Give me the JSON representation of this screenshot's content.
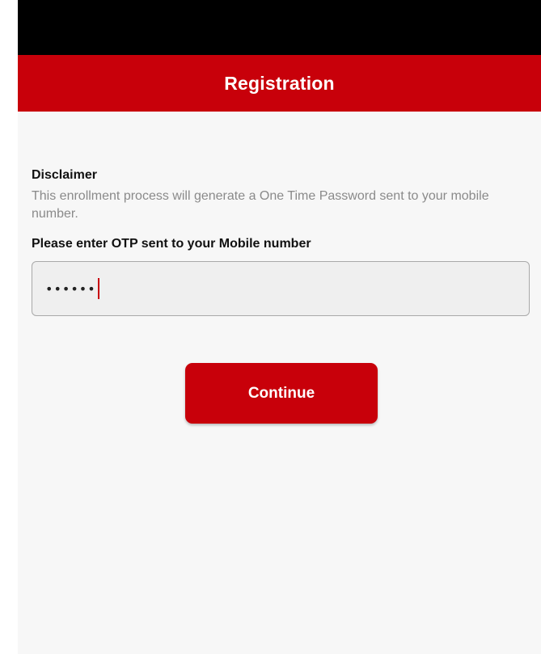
{
  "header": {
    "title": "Registration"
  },
  "disclaimer": {
    "title": "Disclaimer",
    "text": "This enrollment process will generate a One Time Password sent to your mobile number."
  },
  "otp": {
    "label": "Please enter OTP sent to your Mobile number",
    "masked_value": "••••••"
  },
  "actions": {
    "continue_label": "Continue"
  },
  "colors": {
    "brand": "#c8000a",
    "status_bar": "#000000",
    "background": "#f7f7f7"
  }
}
